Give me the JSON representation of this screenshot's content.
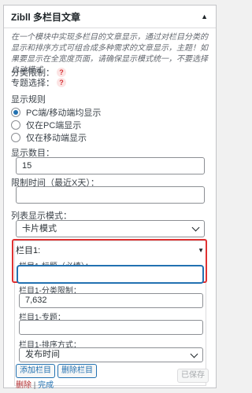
{
  "widget": {
    "title": "Zibll 多栏目文章",
    "description": "在一个模块中实现多栏目的文章显示，通过对栏目分类的显示和排序方式可组合成多种需求的文章显示，主题！如果要显示在全宽度页面，请确保显示模式统一，不要选择自动模式",
    "cat_limit_label": "分类限制：",
    "topic_label": "专题选择：",
    "help_icon": "?"
  },
  "display_rule": {
    "label": "显示规则",
    "options": [
      "PC端/移动端均显示",
      "仅在PC端显示",
      "仅在移动端显示"
    ],
    "selected_index": 0
  },
  "count": {
    "label": "显示数目：",
    "value": "15"
  },
  "time_limit": {
    "label": "限制时间（最近X天）：",
    "value": ""
  },
  "list_style": {
    "label": "列表显示模式：",
    "value": "卡片模式"
  },
  "column1": {
    "header": "栏目1:",
    "title_label": "栏目1-标题（必填）：",
    "title_value": "",
    "cat_label": "栏目1-分类限制：",
    "cat_value": "7,632",
    "topic_label": "栏目1-专题：",
    "topic_value": "",
    "sort_label": "栏目1-排序方式：",
    "sort_value": "发布时间"
  },
  "buttons": {
    "add": "添加栏目",
    "remove": "删除栏目",
    "saved": "已保存"
  },
  "footer": {
    "delete": "删除",
    "sep": "|",
    "done": "完成"
  }
}
